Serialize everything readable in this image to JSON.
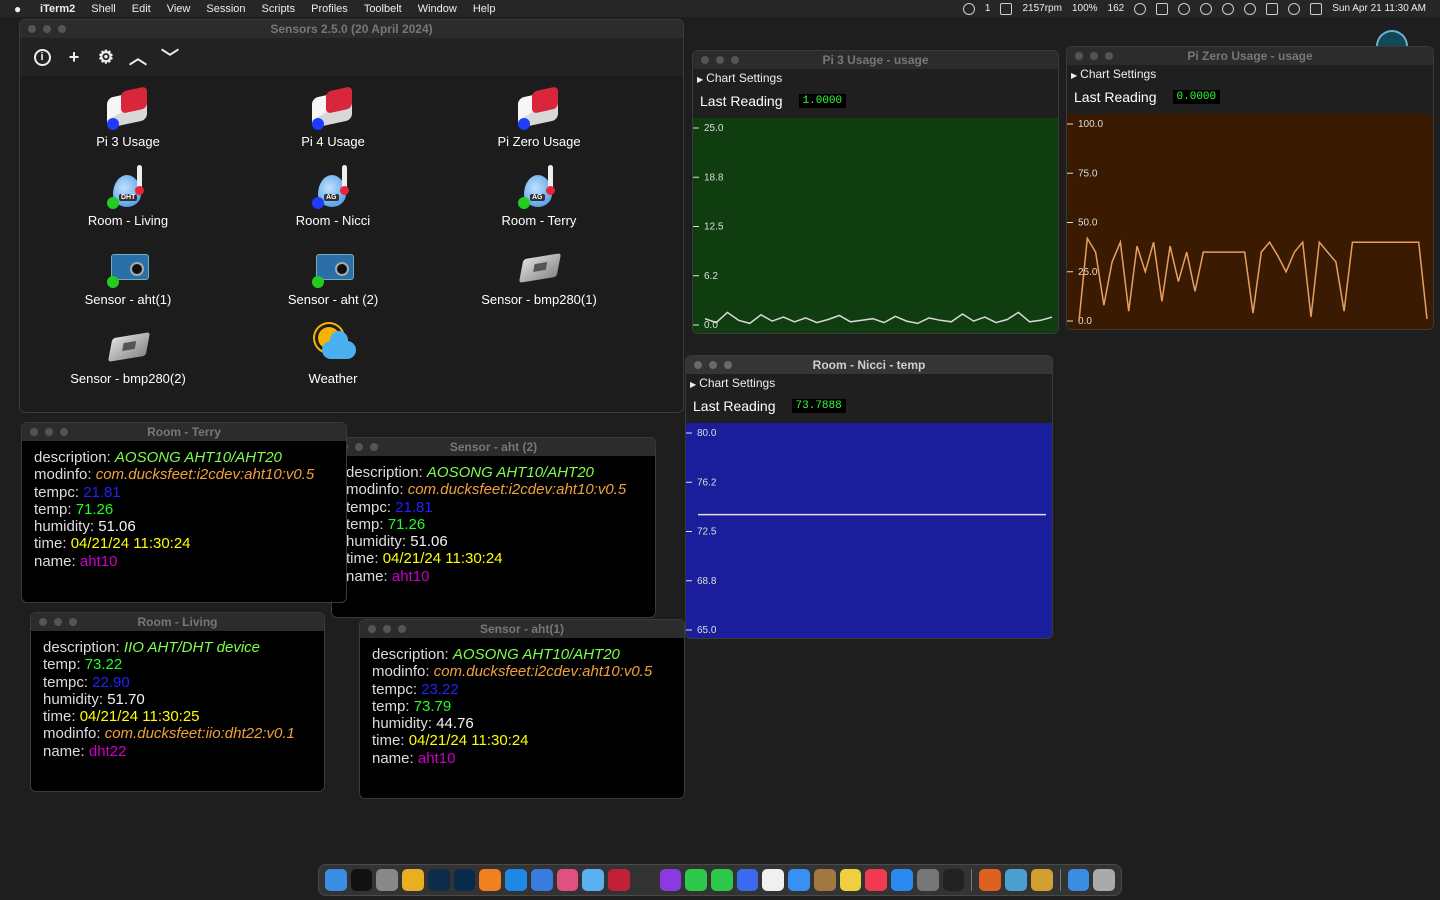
{
  "menubar": {
    "app": "iTerm2",
    "items": [
      "Shell",
      "Edit",
      "View",
      "Session",
      "Scripts",
      "Profiles",
      "Toolbelt",
      "Window",
      "Help"
    ],
    "status": {
      "badge_count": "1",
      "rpm": "2157rpm",
      "battery": "100%",
      "temp": "162",
      "clock": "Sun Apr 21  11:30 AM"
    }
  },
  "main_window": {
    "title": "Sensors 2.5.0 (20 April 2024)",
    "tiles": [
      {
        "label": "Pi 3 Usage",
        "icon": "raspberry-pi-icon",
        "dot": "#1f3bff"
      },
      {
        "label": "Pi 4 Usage",
        "icon": "raspberry-pi-icon",
        "dot": "#1f3bff"
      },
      {
        "label": "Pi Zero Usage",
        "icon": "raspberry-pi-icon",
        "dot": "#1f3bff"
      },
      {
        "label": "Room - Living",
        "icon": "humidity-drop-icon",
        "tag": "DHT",
        "dot": "#22cc22"
      },
      {
        "label": "Room - Nicci",
        "icon": "humidity-drop-icon",
        "tag": "AG",
        "dot": "#1f3bff"
      },
      {
        "label": "Room - Terry",
        "icon": "humidity-drop-icon",
        "tag": "AG",
        "dot": "#22cc22"
      },
      {
        "label": "Sensor - aht(1)",
        "icon": "sensor-board-icon",
        "dot": "#22cc22"
      },
      {
        "label": "Sensor - aht (2)",
        "icon": "sensor-board-icon",
        "dot": "#22cc22"
      },
      {
        "label": "Sensor - bmp280(1)",
        "icon": "sensor-chip-icon"
      },
      {
        "label": "Sensor - bmp280(2)",
        "icon": "sensor-chip-icon"
      },
      {
        "label": "Weather",
        "icon": "weather-icon"
      }
    ]
  },
  "charts": {
    "pi3": {
      "title": "Pi 3 Usage - usage",
      "settings": "Chart Settings",
      "last_label": "Last Reading",
      "last_value": "1.0000"
    },
    "pizero": {
      "title": "Pi Zero Usage - usage",
      "settings": "Chart Settings",
      "last_label": "Last Reading",
      "last_value": "0.0000"
    },
    "nicci": {
      "title": "Room - Nicci - temp",
      "settings": "Chart Settings",
      "last_label": "Last Reading",
      "last_value": "73.7888"
    }
  },
  "chart_data": [
    {
      "type": "line",
      "title": "Pi 3 Usage - usage",
      "ylim": [
        0,
        25
      ],
      "yticks": [
        "25.0",
        "18.8",
        "12.5",
        "6.2",
        "0.0"
      ],
      "values": [
        0.8,
        0.3,
        1.6,
        0.6,
        0.2,
        1.3,
        0.5,
        1.0,
        0.4,
        0.9,
        0.3,
        0.7,
        1.2,
        0.4,
        0.6,
        0.8,
        0.3,
        1.1,
        0.5,
        0.2,
        0.9,
        0.6,
        0.4,
        1.4,
        0.5,
        1.0,
        0.3,
        0.7,
        1.6,
        0.4,
        0.6,
        1.0
      ],
      "background": "#0f3d0f",
      "line_color": "#d9d9d9"
    },
    {
      "type": "line",
      "title": "Pi Zero Usage - usage",
      "ylim": [
        0,
        100
      ],
      "yticks": [
        "100.0",
        "75.0",
        "50.0",
        "25.0",
        "0.0"
      ],
      "values": [
        0,
        42,
        35,
        8,
        30,
        40,
        5,
        38,
        25,
        40,
        10,
        38,
        20,
        35,
        15,
        35,
        35,
        35,
        35,
        35,
        35,
        4,
        35,
        40,
        33,
        25,
        35,
        40,
        2,
        40,
        35,
        30,
        5,
        40,
        40,
        40,
        40,
        40,
        40,
        40,
        40,
        40,
        1
      ],
      "background": "#3a1a00",
      "line_color": "#e8a060"
    },
    {
      "type": "line",
      "title": "Room - Nicci - temp",
      "ylim": [
        65,
        80
      ],
      "yticks": [
        "80.0",
        "76.2",
        "72.5",
        "68.8",
        "65.0"
      ],
      "values": [
        73.79,
        73.79,
        73.79,
        73.79,
        73.79,
        73.79,
        73.79,
        73.79
      ],
      "background": "#1a1e9a",
      "line_color": "#e0e0e0"
    }
  ],
  "info_windows": {
    "terry": {
      "title": "Room - Terry",
      "rows": [
        {
          "k": "description",
          "v": "AOSONG AHT10/AHT20",
          "c": "c-lime"
        },
        {
          "k": "modinfo",
          "v": "com.ducksfeet:i2cdev:aht10:v0.5",
          "c": "c-orange"
        },
        {
          "k": "tempc",
          "v": "21.81",
          "c": "c-blue"
        },
        {
          "k": "temp",
          "v": "71.26",
          "c": "c-green"
        },
        {
          "k": "humidity",
          "v": "51.06",
          "c": "c-white"
        },
        {
          "k": "time",
          "v": "04/21/24 11:30:24",
          "c": "c-yellow"
        },
        {
          "k": "name",
          "v": "aht10",
          "c": "c-magenta"
        }
      ]
    },
    "aht2": {
      "title": "Sensor - aht (2)",
      "rows": [
        {
          "k": "description",
          "v": "AOSONG AHT10/AHT20",
          "c": "c-lime"
        },
        {
          "k": "modinfo",
          "v": "com.ducksfeet:i2cdev:aht10:v0.5",
          "c": "c-orange"
        },
        {
          "k": "tempc",
          "v": "21.81",
          "c": "c-blue"
        },
        {
          "k": "temp",
          "v": "71.26",
          "c": "c-green"
        },
        {
          "k": "humidity",
          "v": "51.06",
          "c": "c-white"
        },
        {
          "k": "time",
          "v": "04/21/24 11:30:24",
          "c": "c-yellow"
        },
        {
          "k": "name",
          "v": "aht10",
          "c": "c-magenta"
        }
      ]
    },
    "living": {
      "title": "Room - Living",
      "rows": [
        {
          "k": "description",
          "v": "IIO AHT/DHT device",
          "c": "c-lime"
        },
        {
          "k": "temp",
          "v": "73.22",
          "c": "c-green"
        },
        {
          "k": "tempc",
          "v": "22.90",
          "c": "c-blue"
        },
        {
          "k": "humidity",
          "v": "51.70",
          "c": "c-white"
        },
        {
          "k": "time",
          "v": "04/21/24 11:30:25",
          "c": "c-yellow"
        },
        {
          "k": "modinfo",
          "v": "com.ducksfeet:iio:dht22:v0.1",
          "c": "c-orange"
        },
        {
          "k": "name",
          "v": "dht22",
          "c": "c-magenta"
        }
      ]
    },
    "aht1": {
      "title": "Sensor - aht(1)",
      "rows": [
        {
          "k": "description",
          "v": "AOSONG AHT10/AHT20",
          "c": "c-lime"
        },
        {
          "k": "modinfo",
          "v": "com.ducksfeet:i2cdev:aht10:v0.5",
          "c": "c-orange"
        },
        {
          "k": "tempc",
          "v": "23.22",
          "c": "c-blue"
        },
        {
          "k": "temp",
          "v": "73.79",
          "c": "c-green"
        },
        {
          "k": "humidity",
          "v": "44.76",
          "c": "c-white"
        },
        {
          "k": "time",
          "v": "04/21/24 11:30:24",
          "c": "c-yellow"
        },
        {
          "k": "name",
          "v": "aht10",
          "c": "c-magenta"
        }
      ]
    }
  },
  "dock": {
    "apps": [
      {
        "name": "finder-icon",
        "color": "#3a8de0"
      },
      {
        "name": "terminal-icon",
        "color": "#111111"
      },
      {
        "name": "launchpad-icon",
        "color": "#888888"
      },
      {
        "name": "chrome-icon",
        "color": "#e8b020"
      },
      {
        "name": "lightroom-icon",
        "color": "#0b2d4a"
      },
      {
        "name": "photoshop-icon",
        "color": "#0a2a4a"
      },
      {
        "name": "sublime-icon",
        "color": "#f08020"
      },
      {
        "name": "vscode-icon",
        "color": "#1e88e5"
      },
      {
        "name": "xcode-icon",
        "color": "#3a7be0"
      },
      {
        "name": "photos-icon",
        "color": "#e05080"
      },
      {
        "name": "drop-icon",
        "color": "#5ab0f0"
      },
      {
        "name": "raspberry-icon",
        "color": "#c0203a"
      },
      {
        "name": "chatgpt-icon",
        "color": "#333333"
      },
      {
        "name": "podcast-icon",
        "color": "#8a3ae0"
      },
      {
        "name": "messages-icon",
        "color": "#2ec84a"
      },
      {
        "name": "facetime-icon",
        "color": "#2ec84a"
      },
      {
        "name": "messenger-icon",
        "color": "#3a6af0"
      },
      {
        "name": "calendar-icon",
        "color": "#f0f0f0"
      },
      {
        "name": "mail-icon",
        "color": "#3a90f0"
      },
      {
        "name": "contacts-icon",
        "color": "#a07840"
      },
      {
        "name": "notes-icon",
        "color": "#f0d040"
      },
      {
        "name": "music-icon",
        "color": "#f03a50"
      },
      {
        "name": "appstore-icon",
        "color": "#2a8af0"
      },
      {
        "name": "settings-icon",
        "color": "#777777"
      },
      {
        "name": "activity-icon",
        "color": "#222222"
      },
      {
        "name": "monitor-icon",
        "color": "#e06020"
      },
      {
        "name": "quicktime-icon",
        "color": "#4aa0d0"
      },
      {
        "name": "pen-icon",
        "color": "#d0a030"
      },
      {
        "name": "downloads-icon",
        "color": "#3a8de0"
      },
      {
        "name": "trash-icon",
        "color": "#aaaaaa"
      }
    ]
  }
}
